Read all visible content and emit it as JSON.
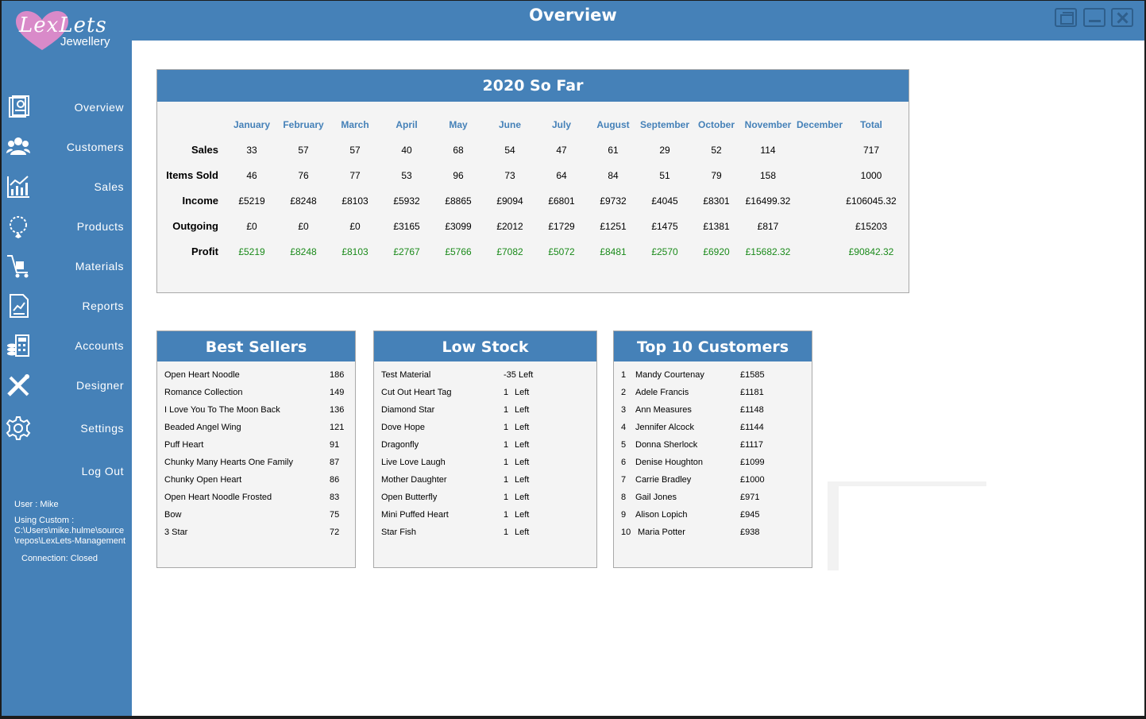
{
  "window": {
    "title": "Overview"
  },
  "brand": {
    "logo_text": "LexLets",
    "logo_sub": "Jewellery"
  },
  "nav": [
    {
      "label": "Overview",
      "icon": "overview-icon"
    },
    {
      "label": "Customers",
      "icon": "customers-icon"
    },
    {
      "label": "Sales",
      "icon": "sales-chart-icon"
    },
    {
      "label": "Products",
      "icon": "necklace-icon"
    },
    {
      "label": "Materials",
      "icon": "trolley-icon"
    },
    {
      "label": "Reports",
      "icon": "report-icon"
    },
    {
      "label": "Accounts",
      "icon": "accounts-icon"
    },
    {
      "label": "Designer",
      "icon": "design-tools-icon"
    },
    {
      "label": "Settings",
      "icon": "gear-icon"
    },
    {
      "label": "Log Out",
      "icon": ""
    }
  ],
  "session": {
    "user": "User : Mike",
    "custom_label": "Using Custom :",
    "path_line1": "C:\\Users\\mike.hulme\\source",
    "path_line2": "\\repos\\LexLets-Management",
    "connection": "Connection: Closed"
  },
  "summary": {
    "title": "2020 So Far",
    "months": [
      "January",
      "February",
      "March",
      "April",
      "May",
      "June",
      "July",
      "August",
      "September",
      "October",
      "November",
      "December",
      "Total"
    ],
    "rows": [
      {
        "label": "Sales",
        "values": [
          "33",
          "57",
          "57",
          "40",
          "68",
          "54",
          "47",
          "61",
          "29",
          "52",
          "114",
          "",
          "717"
        ]
      },
      {
        "label": "Items Sold",
        "values": [
          "46",
          "76",
          "77",
          "53",
          "96",
          "73",
          "64",
          "84",
          "51",
          "79",
          "158",
          "",
          "1000"
        ]
      },
      {
        "label": "Income",
        "values": [
          "£5219",
          "£8248",
          "£8103",
          "£5932",
          "£8865",
          "£9094",
          "£6801",
          "£9732",
          "£4045",
          "£8301",
          "£16499.32",
          "",
          "£106045.32"
        ]
      },
      {
        "label": "Outgoing",
        "values": [
          "£0",
          "£0",
          "£0",
          "£3165",
          "£3099",
          "£2012",
          "£1729",
          "£1251",
          "£1475",
          "£1381",
          "£817",
          "",
          "£15203"
        ]
      },
      {
        "label": "Profit",
        "values": [
          "£5219",
          "£8248",
          "£8103",
          "£2767",
          "£5766",
          "£7082",
          "£5072",
          "£8481",
          "£2570",
          "£6920",
          "£15682.32",
          "",
          "£90842.32"
        ]
      }
    ]
  },
  "best_sellers": {
    "title": "Best Sellers",
    "items": [
      {
        "name": "Open Heart Noodle",
        "count": "186"
      },
      {
        "name": "Romance Collection",
        "count": "149"
      },
      {
        "name": "I Love You To The Moon  Back",
        "count": "136"
      },
      {
        "name": "Beaded Angel Wing",
        "count": "121"
      },
      {
        "name": "Puff Heart",
        "count": "91"
      },
      {
        "name": "Chunky Many Hearts One Family",
        "count": "87"
      },
      {
        "name": "Chunky Open Heart",
        "count": "86"
      },
      {
        "name": "Open Heart Noodle  Frosted",
        "count": "83"
      },
      {
        "name": "Bow",
        "count": "75"
      },
      {
        "name": "3 Star",
        "count": "72"
      }
    ]
  },
  "low_stock": {
    "title": "Low Stock",
    "items": [
      {
        "name": "Test Material",
        "qty": "-35",
        "unit": "Left"
      },
      {
        "name": "Cut Out Heart Tag",
        "qty": "1",
        "unit": "Left"
      },
      {
        "name": "Diamond Star",
        "qty": "1",
        "unit": "Left"
      },
      {
        "name": "Dove Hope",
        "qty": "1",
        "unit": "Left"
      },
      {
        "name": "Dragonfly",
        "qty": "1",
        "unit": "Left"
      },
      {
        "name": "Live Love Laugh",
        "qty": "1",
        "unit": "Left"
      },
      {
        "name": "Mother  Daughter",
        "qty": "1",
        "unit": "Left"
      },
      {
        "name": "Open Butterfly",
        "qty": "1",
        "unit": "Left"
      },
      {
        "name": "Mini Puffed Heart",
        "qty": "1",
        "unit": "Left"
      },
      {
        "name": "Star Fish",
        "qty": "1",
        "unit": "Left"
      }
    ]
  },
  "top_customers": {
    "title": "Top 10 Customers",
    "items": [
      {
        "rank": "1",
        "name": "Mandy Courtenay",
        "amount": "£1585"
      },
      {
        "rank": "2",
        "name": "Adele Francis",
        "amount": "£1181"
      },
      {
        "rank": "3",
        "name": "Ann Measures",
        "amount": "£1148"
      },
      {
        "rank": "4",
        "name": "Jennifer Alcock",
        "amount": "£1144"
      },
      {
        "rank": "5",
        "name": "Donna Sherlock",
        "amount": "£1117"
      },
      {
        "rank": "6",
        "name": "Denise Houghton",
        "amount": "£1099"
      },
      {
        "rank": "7",
        "name": "Carrie Bradley",
        "amount": "£1000"
      },
      {
        "rank": "8",
        "name": "Gail Jones",
        "amount": "£971"
      },
      {
        "rank": "9",
        "name": "Alison Lopich",
        "amount": "£945"
      },
      {
        "rank": "10",
        "name": "Maria Potter",
        "amount": "£938"
      }
    ]
  },
  "colors": {
    "accent": "#4581b8",
    "profit": "#1a8a1a",
    "panel_bg": "#f4f4f4"
  }
}
